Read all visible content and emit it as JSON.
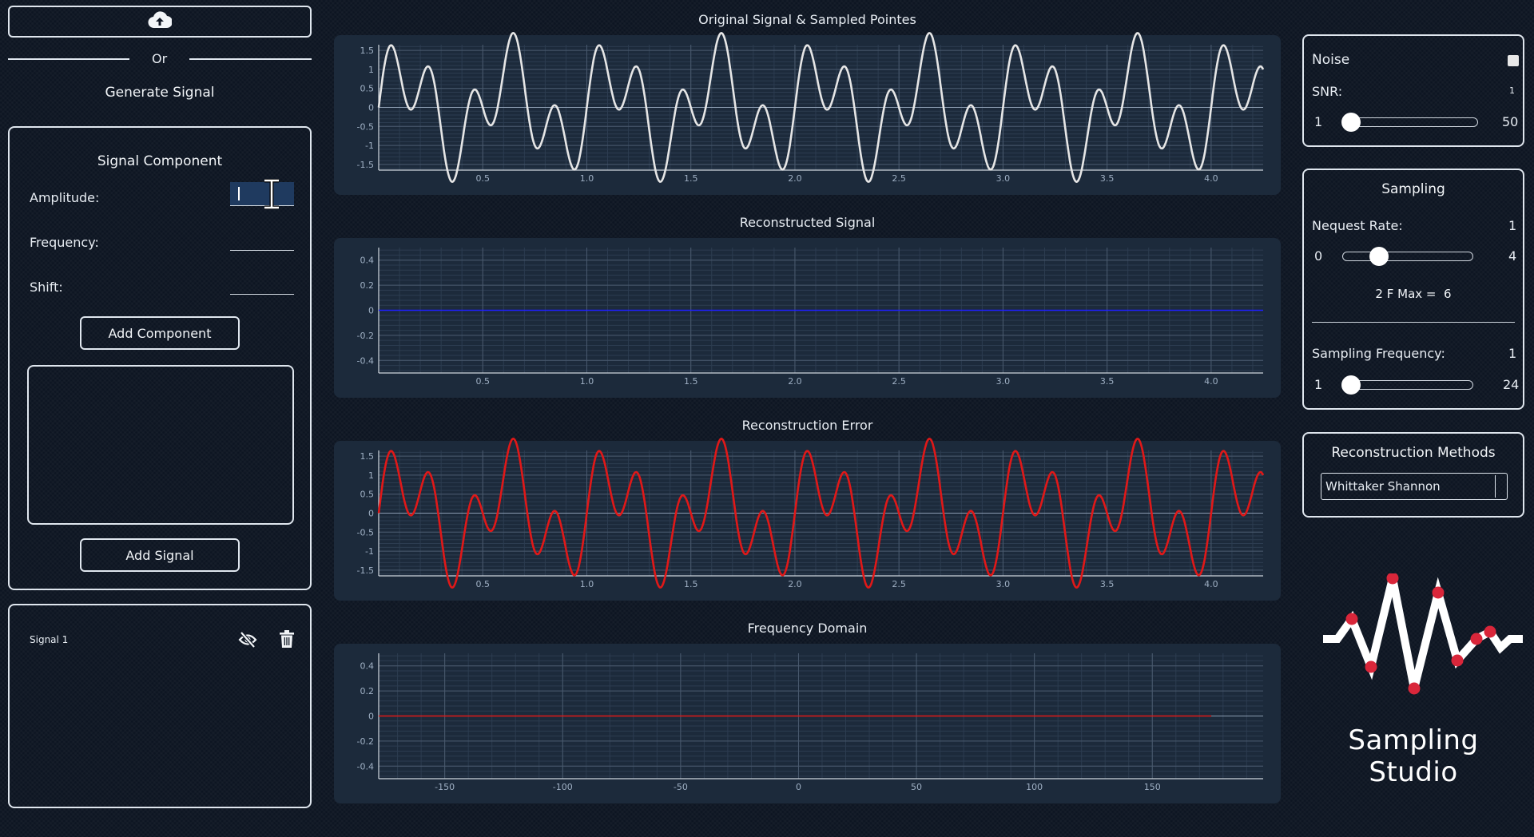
{
  "left": {
    "upload_icon": "cloud-upload-icon",
    "or_text": "Or",
    "generate_title": "Generate Signal",
    "component_panel": {
      "title": "Signal Component",
      "amplitude_label": "Amplitude:",
      "amplitude_value": "",
      "frequency_label": "Frequency:",
      "frequency_value": "",
      "shift_label": "Shift:",
      "shift_value": "",
      "add_component_label": "Add Component",
      "add_signal_label": "Add Signal"
    },
    "signals": [
      {
        "name": "Signal 1",
        "visibility_icon": "eye-off-icon",
        "delete_icon": "trash-icon"
      }
    ]
  },
  "plots": [
    {
      "title": "Original Signal & Sampled Pointes"
    },
    {
      "title": "Reconstructed Signal"
    },
    {
      "title": "Reconstruction Error"
    },
    {
      "title": "Frequency Domain"
    }
  ],
  "chart_data": [
    {
      "type": "line",
      "title": "Original Signal & Sampled Pointes",
      "xlim": [
        0,
        4.25
      ],
      "ylim": [
        -1.65,
        1.65
      ],
      "xticks": [
        "0.5",
        "1.0",
        "1.5",
        "2.0",
        "2.5",
        "3.0",
        "3.5",
        "4.0"
      ],
      "yticks": [
        "1.5",
        "1",
        "0.5",
        "0",
        "-0.5",
        "-1",
        "-1.5"
      ],
      "series": [
        {
          "formula": "sin(2π·5t)+sin(2π·2t)",
          "color": "#e6e6e6"
        }
      ]
    },
    {
      "type": "line",
      "title": "Reconstructed Signal",
      "xlim": [
        0,
        4.25
      ],
      "ylim": [
        -0.5,
        0.5
      ],
      "xticks": [
        "0.5",
        "1.0",
        "1.5",
        "2.0",
        "2.5",
        "3.0",
        "3.5",
        "4.0"
      ],
      "yticks": [
        "0.4",
        "0.2",
        "0",
        "-0.2",
        "-0.4"
      ],
      "series": [
        {
          "values": "constant 0",
          "color": "#1f1fff"
        }
      ]
    },
    {
      "type": "line",
      "title": "Reconstruction Error",
      "xlim": [
        0,
        4.25
      ],
      "ylim": [
        -1.65,
        1.65
      ],
      "xticks": [
        "0.5",
        "1.0",
        "1.5",
        "2.0",
        "2.5",
        "3.0",
        "3.5",
        "4.0"
      ],
      "yticks": [
        "1.5",
        "1",
        "0.5",
        "0",
        "-0.5",
        "-1",
        "-1.5"
      ],
      "series": [
        {
          "formula": "sin(2π·5t)+sin(2π·2t)",
          "color": "#e01818"
        }
      ]
    },
    {
      "type": "line",
      "title": "Frequency Domain",
      "xlim": [
        -178,
        197
      ],
      "ylim": [
        -0.5,
        0.5
      ],
      "xticks": [
        "-150",
        "-100",
        "-50",
        "0",
        "50",
        "100",
        "150"
      ],
      "yticks": [
        "0.4",
        "0.2",
        "0",
        "-0.2",
        "-0.4"
      ],
      "series": [
        {
          "values": "constant 0 from -178 to 175",
          "color": "#e01818"
        }
      ]
    }
  ],
  "right": {
    "noise": {
      "title": "Noise",
      "snr_label": "SNR:",
      "snr_value": "1",
      "min": "1",
      "max": "50",
      "level": 0.0
    },
    "sampling": {
      "title": "Sampling",
      "nyquist_label": "Nequest Rate:",
      "nyquist_value": "1",
      "nyquist_min": "0",
      "nyquist_max": "4",
      "nyquist_level": 0.25,
      "fmax_text": "2 F Max =  6",
      "sf_label": "Sampling Frequency:",
      "sf_value": "1",
      "sf_min": "1",
      "sf_max": "24",
      "sf_level": 0.0
    },
    "reconstruction": {
      "title": "Reconstruction Methods",
      "selected": "Whittaker Shannon"
    },
    "logo_text": "Sampling Studio",
    "accent": "#d9263a"
  }
}
